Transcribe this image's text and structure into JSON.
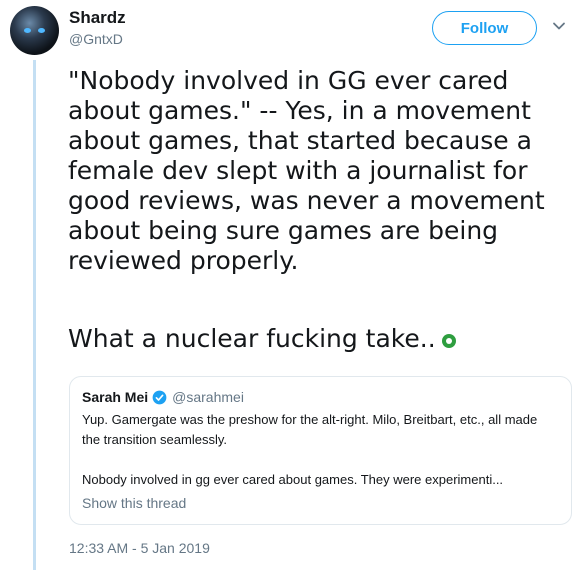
{
  "author": {
    "name": "Shardz",
    "handle": "@GntxD"
  },
  "follow_label": "Follow",
  "tweet": {
    "body": "\"Nobody involved in GG ever cared about games.\" -- Yes, in a movement about games, that started because a female dev slept with a journalist for good reviews, was never a movement about being sure games are being reviewed properly.",
    "closing": "What a nuclear fucking take..",
    "emoji": "ok-hand-emoji"
  },
  "quoted": {
    "name": "Sarah Mei",
    "handle": "@sarahmei",
    "paragraph1": "Yup. Gamergate was the preshow for the alt-right. Milo, Breitbart, etc., all made the transition seamlessly.",
    "paragraph2": "Nobody involved in gg ever cared about games. They were experimenti...",
    "show_thread": "Show this thread"
  },
  "timestamp": "12:33 AM - 5 Jan 2019",
  "colors": {
    "accent": "#1da1f2",
    "thread_line": "#c4dff3",
    "muted": "#657786"
  }
}
